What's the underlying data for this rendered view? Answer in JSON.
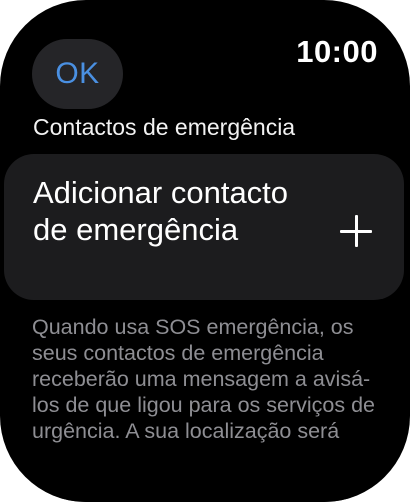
{
  "header": {
    "ok_label": "OK",
    "time": "10:00"
  },
  "section": {
    "title": "Contactos de emergência"
  },
  "add_contact": {
    "label": "Adicionar contacto de emergência",
    "icon": "plus-icon"
  },
  "description": {
    "text": "Quando usa SOS emergência, os seus contactos de emergência receberão uma mensagem a avisá-los de que ligou para os serviços de urgência. A sua localização será"
  },
  "colors": {
    "background": "#000000",
    "card": "#1c1c1e",
    "ok_text": "#4a90e2",
    "secondary_text": "#8e8e93"
  }
}
